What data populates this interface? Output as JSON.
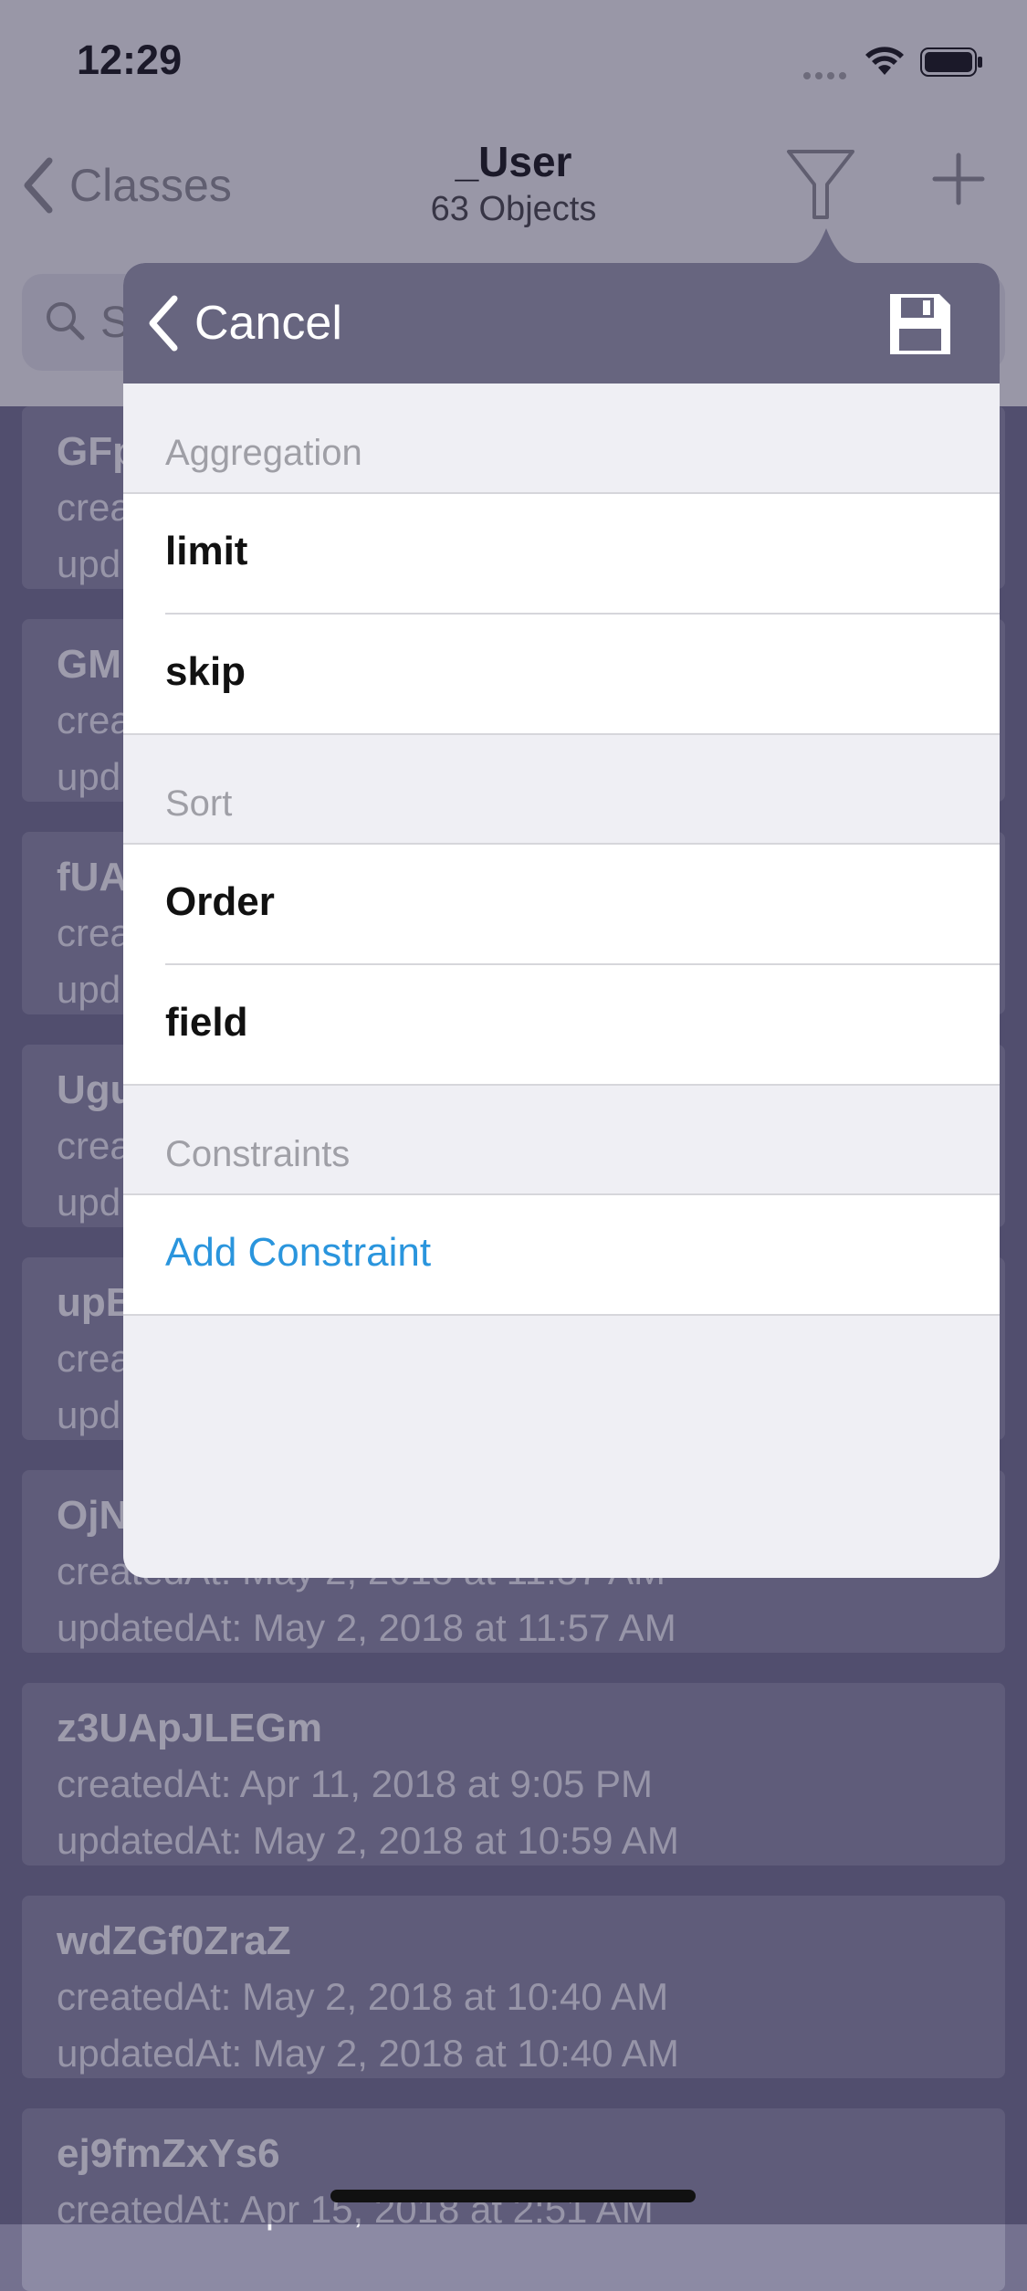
{
  "status": {
    "time": "12:29"
  },
  "nav": {
    "back_label": "Classes",
    "title": "_User",
    "subtitle": "63 Objects"
  },
  "search": {
    "placeholder": "S"
  },
  "list": [
    {
      "id": "GFp",
      "created": "crea",
      "updated": "upd"
    },
    {
      "id": "GM",
      "created": "crea",
      "updated": "upd"
    },
    {
      "id": "fUA",
      "created": "crea",
      "updated": "upd"
    },
    {
      "id": "Ugu",
      "created": "crea",
      "updated": "upd"
    },
    {
      "id": "upB",
      "created": "crea",
      "updated": "upd"
    },
    {
      "id": "OjN",
      "created": "createdAt: May 2, 2018 at 11:57 AM",
      "updated": "updatedAt: May 2, 2018 at 11:57 AM"
    },
    {
      "id": "z3UApJLEGm",
      "created": "createdAt: Apr 11, 2018 at 9:05 PM",
      "updated": "updatedAt: May 2, 2018 at 10:59 AM"
    },
    {
      "id": "wdZGf0ZraZ",
      "created": "createdAt: May 2, 2018 at 10:40 AM",
      "updated": "updatedAt: May 2, 2018 at 10:40 AM"
    },
    {
      "id": "ej9fmZxYs6",
      "created": "createdAt: Apr 15, 2018 at 2:51 AM",
      "updated": ""
    }
  ],
  "popover": {
    "cancel_label": "Cancel",
    "sections": {
      "aggregation": "Aggregation",
      "sort": "Sort",
      "constraints": "Constraints"
    },
    "rows": {
      "limit": "limit",
      "skip": "skip",
      "order": "Order",
      "field": "field",
      "add_constraint": "Add Constraint"
    }
  },
  "colors": {
    "popover_header": "#67657f",
    "link": "#2a95dd",
    "card": "#8c8aa4"
  }
}
